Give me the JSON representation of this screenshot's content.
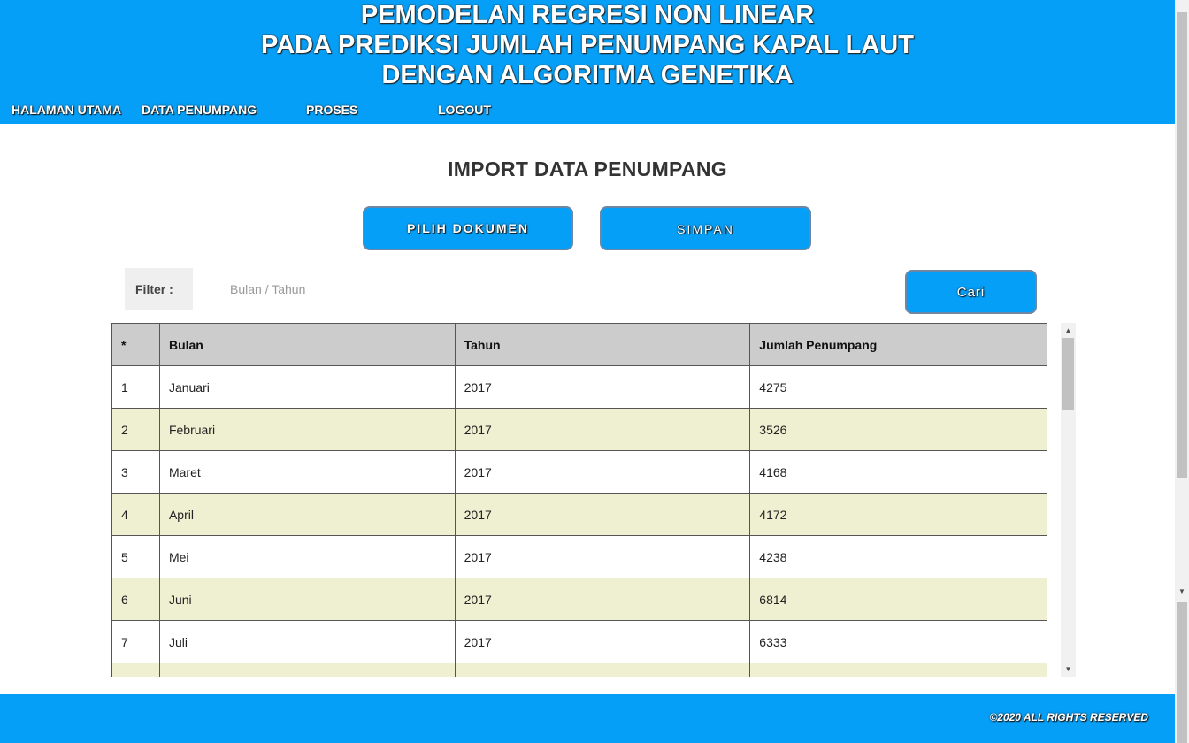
{
  "header": {
    "title_lines": [
      "PEMODELAN REGRESI NON LINEAR",
      "PADA PREDIKSI JUMLAH PENUMPANG KAPAL LAUT",
      "DENGAN ALGORITMA GENETIKA"
    ],
    "nav": [
      {
        "label": "HALAMAN UTAMA"
      },
      {
        "label": "DATA PENUMPANG"
      },
      {
        "label": "PROSES"
      },
      {
        "label": "LOGOUT"
      }
    ]
  },
  "main": {
    "title": "IMPORT DATA PENUMPANG",
    "pilih_label": "PILIH DOKUMEN",
    "simpan_label": "SIMPAN",
    "filter_label": "Filter :",
    "filter_placeholder": "Bulan / Tahun",
    "filter_value": "",
    "cari_label": "Cari"
  },
  "table": {
    "headers": [
      "*",
      "Bulan",
      "Tahun",
      "Jumlah Penumpang"
    ],
    "rows": [
      [
        "1",
        "Januari",
        "2017",
        "4275"
      ],
      [
        "2",
        "Februari",
        "2017",
        "3526"
      ],
      [
        "3",
        "Maret",
        "2017",
        "4168"
      ],
      [
        "4",
        "April",
        "2017",
        "4172"
      ],
      [
        "5",
        "Mei",
        "2017",
        "4238"
      ],
      [
        "6",
        "Juni",
        "2017",
        "6814"
      ],
      [
        "7",
        "Juli",
        "2017",
        "6333"
      ],
      [
        "",
        "",
        "",
        ""
      ]
    ]
  },
  "footer": {
    "copyright": "©2020 ALL RIGHTS RESERVED"
  },
  "colors": {
    "brand": "#069ff7",
    "row_alt": "#efefd1",
    "header_cell": "#cccccc"
  },
  "icons": {
    "scroll_up": "scroll-up-arrow-icon",
    "scroll_down": "scroll-down-arrow-icon"
  }
}
